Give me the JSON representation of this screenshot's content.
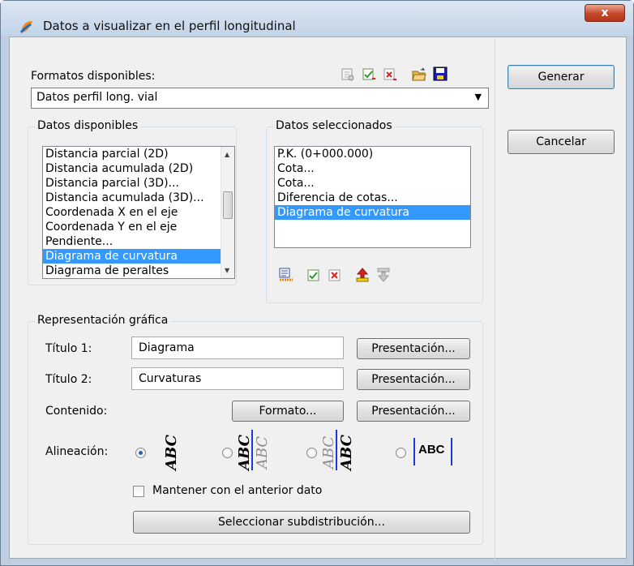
{
  "window": {
    "title": "Datos a visualizar en el perfil longitudinal",
    "close_symbol": "x"
  },
  "formats": {
    "label": "Formatos disponibles:",
    "selected": "Datos perfil long. vial",
    "toolbar_icons": [
      "properties-icon",
      "rename-icon",
      "delete-format-icon",
      "open-folder-icon",
      "save-icon"
    ]
  },
  "available": {
    "title": "Datos disponibles",
    "items": [
      "Distancia parcial (2D)",
      "Distancia acumulada (2D)",
      "Distancia parcial (3D)...",
      "Distancia acumulada (3D)...",
      "Coordenada X en el eje",
      "Coordenada Y en el eje",
      "Pendiente...",
      "Diagrama de curvatura",
      "Diagrama de peraltes"
    ],
    "selected_index": 7
  },
  "selected_data": {
    "title": "Datos seleccionados",
    "items": [
      "P.K. (0+000.000)",
      "Cota...",
      "Cota...",
      "Diferencia de cotas...",
      "Diagrama de curvatura"
    ],
    "selected_index": 4,
    "toolbar_icons": [
      "list-format-icon",
      "check-icon",
      "remove-icon",
      "move-up-icon",
      "move-down-icon"
    ]
  },
  "graphic": {
    "title": "Representación gráfica",
    "titulo1_label": "Título 1:",
    "titulo1_value": "Diagrama",
    "titulo2_label": "Título 2:",
    "titulo2_value": "Curvaturas",
    "contenido_label": "Contenido:",
    "formato_button": "Formato...",
    "presentacion_button": "Presentación...",
    "alineacion_label": "Alineación:",
    "alignment_options": [
      "ABC",
      "ABC",
      "ABC",
      "ABC"
    ],
    "alignment_selected": 0,
    "keep_label": "Mantener con el anterior dato",
    "keep_checked": false,
    "subdist_button": "Seleccionar subdistribución..."
  },
  "actions": {
    "generate": "Generar",
    "cancel": "Cancelar"
  },
  "colors": {
    "selection": "#3399ff",
    "alignment_bar": "#1b3bd6"
  }
}
